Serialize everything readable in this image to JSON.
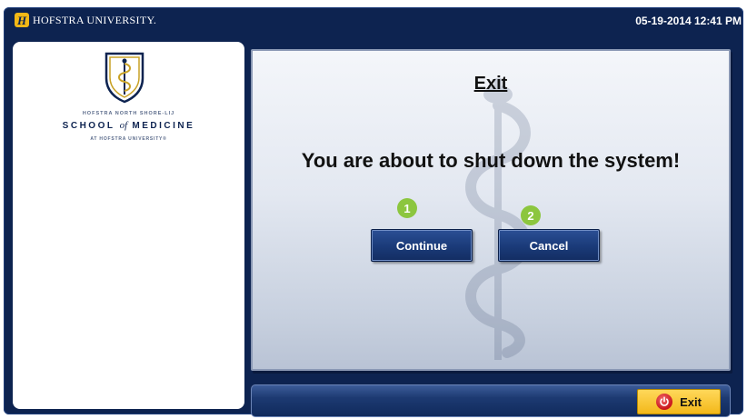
{
  "header": {
    "brand_mark": "H",
    "brand_name": "HOFSTRA UNIVERSITY.",
    "datetime": "05-19-2014 12:41 PM"
  },
  "sidebar": {
    "school_top": "HOFSTRA NORTH SHORE-LIJ",
    "school_main_left": "SCHOOL",
    "school_main_of": "of",
    "school_main_right": "MEDICINE",
    "school_bottom": "AT HOFSTRA UNIVERSITY®"
  },
  "dialog": {
    "title": "Exit",
    "message": "You are about to shut down the system!",
    "step1": "1",
    "step2": "2",
    "continue_label": "Continue",
    "cancel_label": "Cancel"
  },
  "footer": {
    "exit_label": "Exit",
    "exit_icon": "power-icon"
  },
  "colors": {
    "frame": "#0d2350",
    "button": "#1a3a78",
    "exit_button": "#f3b81a",
    "step_badge": "#8cc63f"
  }
}
